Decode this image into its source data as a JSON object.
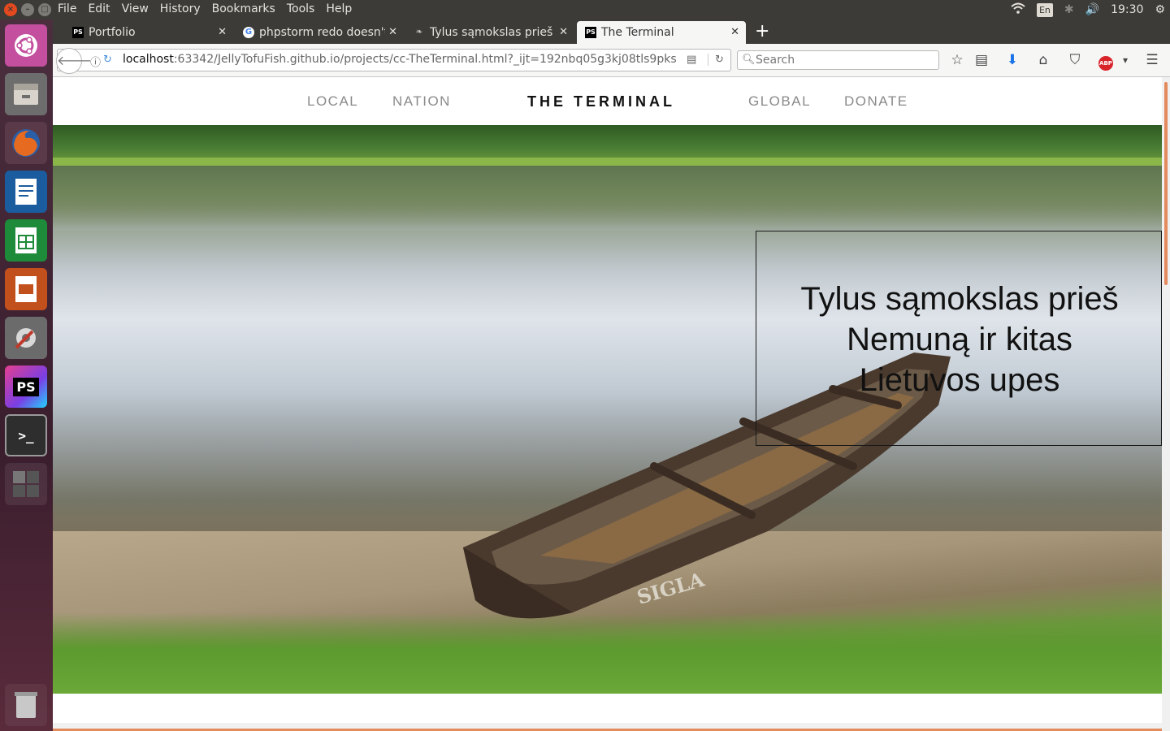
{
  "menubar": {
    "items": [
      "File",
      "Edit",
      "View",
      "History",
      "Bookmarks",
      "Tools",
      "Help"
    ],
    "lang": "En",
    "clock": "19:30"
  },
  "tabs": [
    {
      "label": "Portfolio",
      "icon": "PS"
    },
    {
      "label": "phpstorm redo doesn't",
      "icon": "google-icon"
    },
    {
      "label": "Tylus sąmokslas prieš N",
      "icon": "leaf-icon"
    },
    {
      "label": "The Terminal",
      "icon": "PS"
    }
  ],
  "url": {
    "host": "localhost",
    "rest": ":63342/JellyTofuFish.github.io/projects/cc-TheTerminal.html?_ijt=192nbq05g3kj08tls9pks"
  },
  "search": {
    "placeholder": "Search"
  },
  "launcher": {
    "phpstorm_label": "PS"
  },
  "site": {
    "nav_local": "LOCAL",
    "nav_nation": "NATION",
    "brand": "THE TERMINAL",
    "nav_global": "GLOBAL",
    "nav_donate": "DONATE"
  },
  "hero": {
    "headline_1": "Tylus sąmokslas prieš",
    "headline_2": "Nemuną ir kitas",
    "headline_3": "Lietuvos upes",
    "boat_name": "SIGLA"
  },
  "colors": {
    "accent": "#e38a5e",
    "ubuntu_orange": "#e2491f"
  }
}
